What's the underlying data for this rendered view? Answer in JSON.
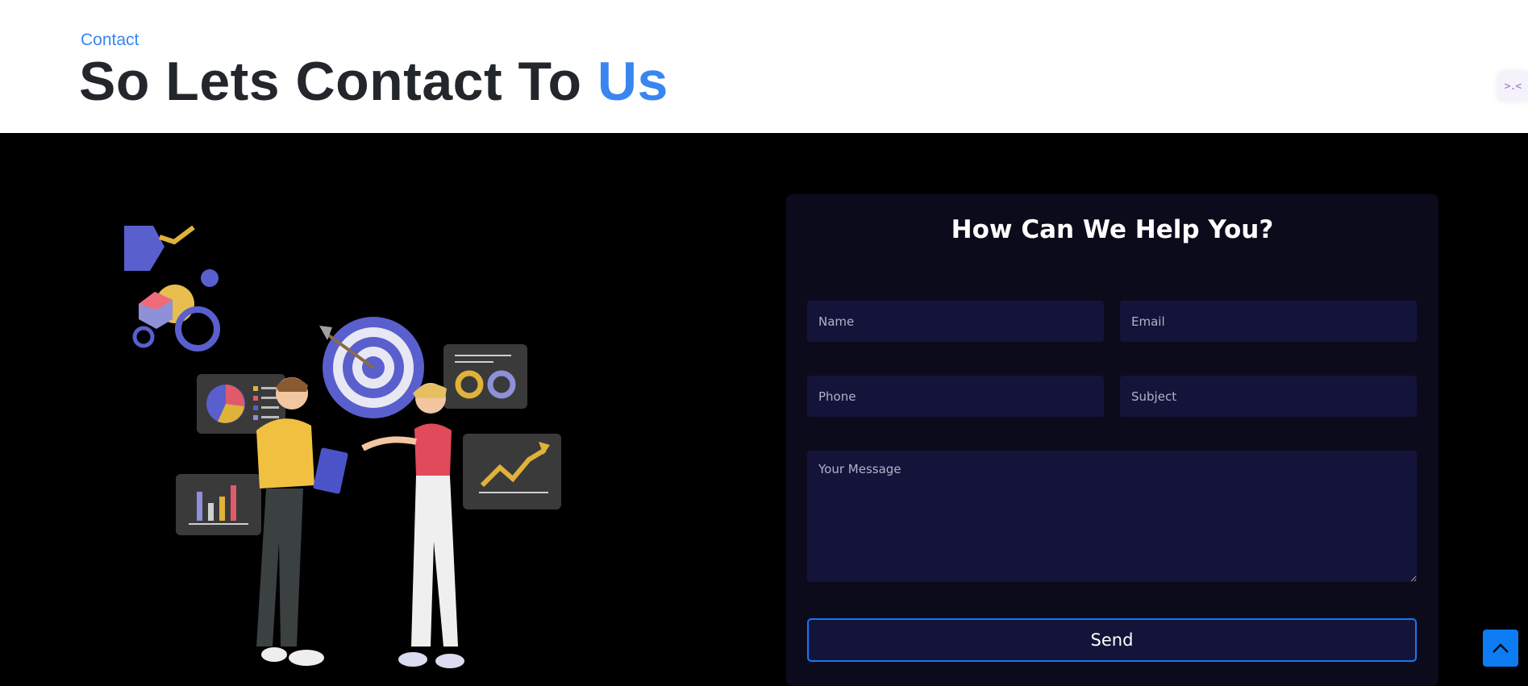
{
  "header": {
    "eyebrow": "Contact",
    "title_main": "So Lets Contact To ",
    "title_accent": "Us"
  },
  "side_widget": {
    "glyph": ">.<"
  },
  "form": {
    "title": "How Can We Help You?",
    "name_placeholder": "Name",
    "email_placeholder": "Email",
    "phone_placeholder": "Phone",
    "subject_placeholder": "Subject",
    "message_placeholder": "Your Message",
    "send_label": "Send"
  },
  "icons": {
    "scroll_top": "chevron-up-icon",
    "illustration": "business-team-illustration"
  },
  "colors": {
    "accent": "#3a86f0",
    "heading": "#23272c",
    "card_bg": "#0c0b1b",
    "input_bg": "#14143a",
    "button_border": "#1877f2",
    "scroll_top_bg": "#0d7cf2"
  }
}
